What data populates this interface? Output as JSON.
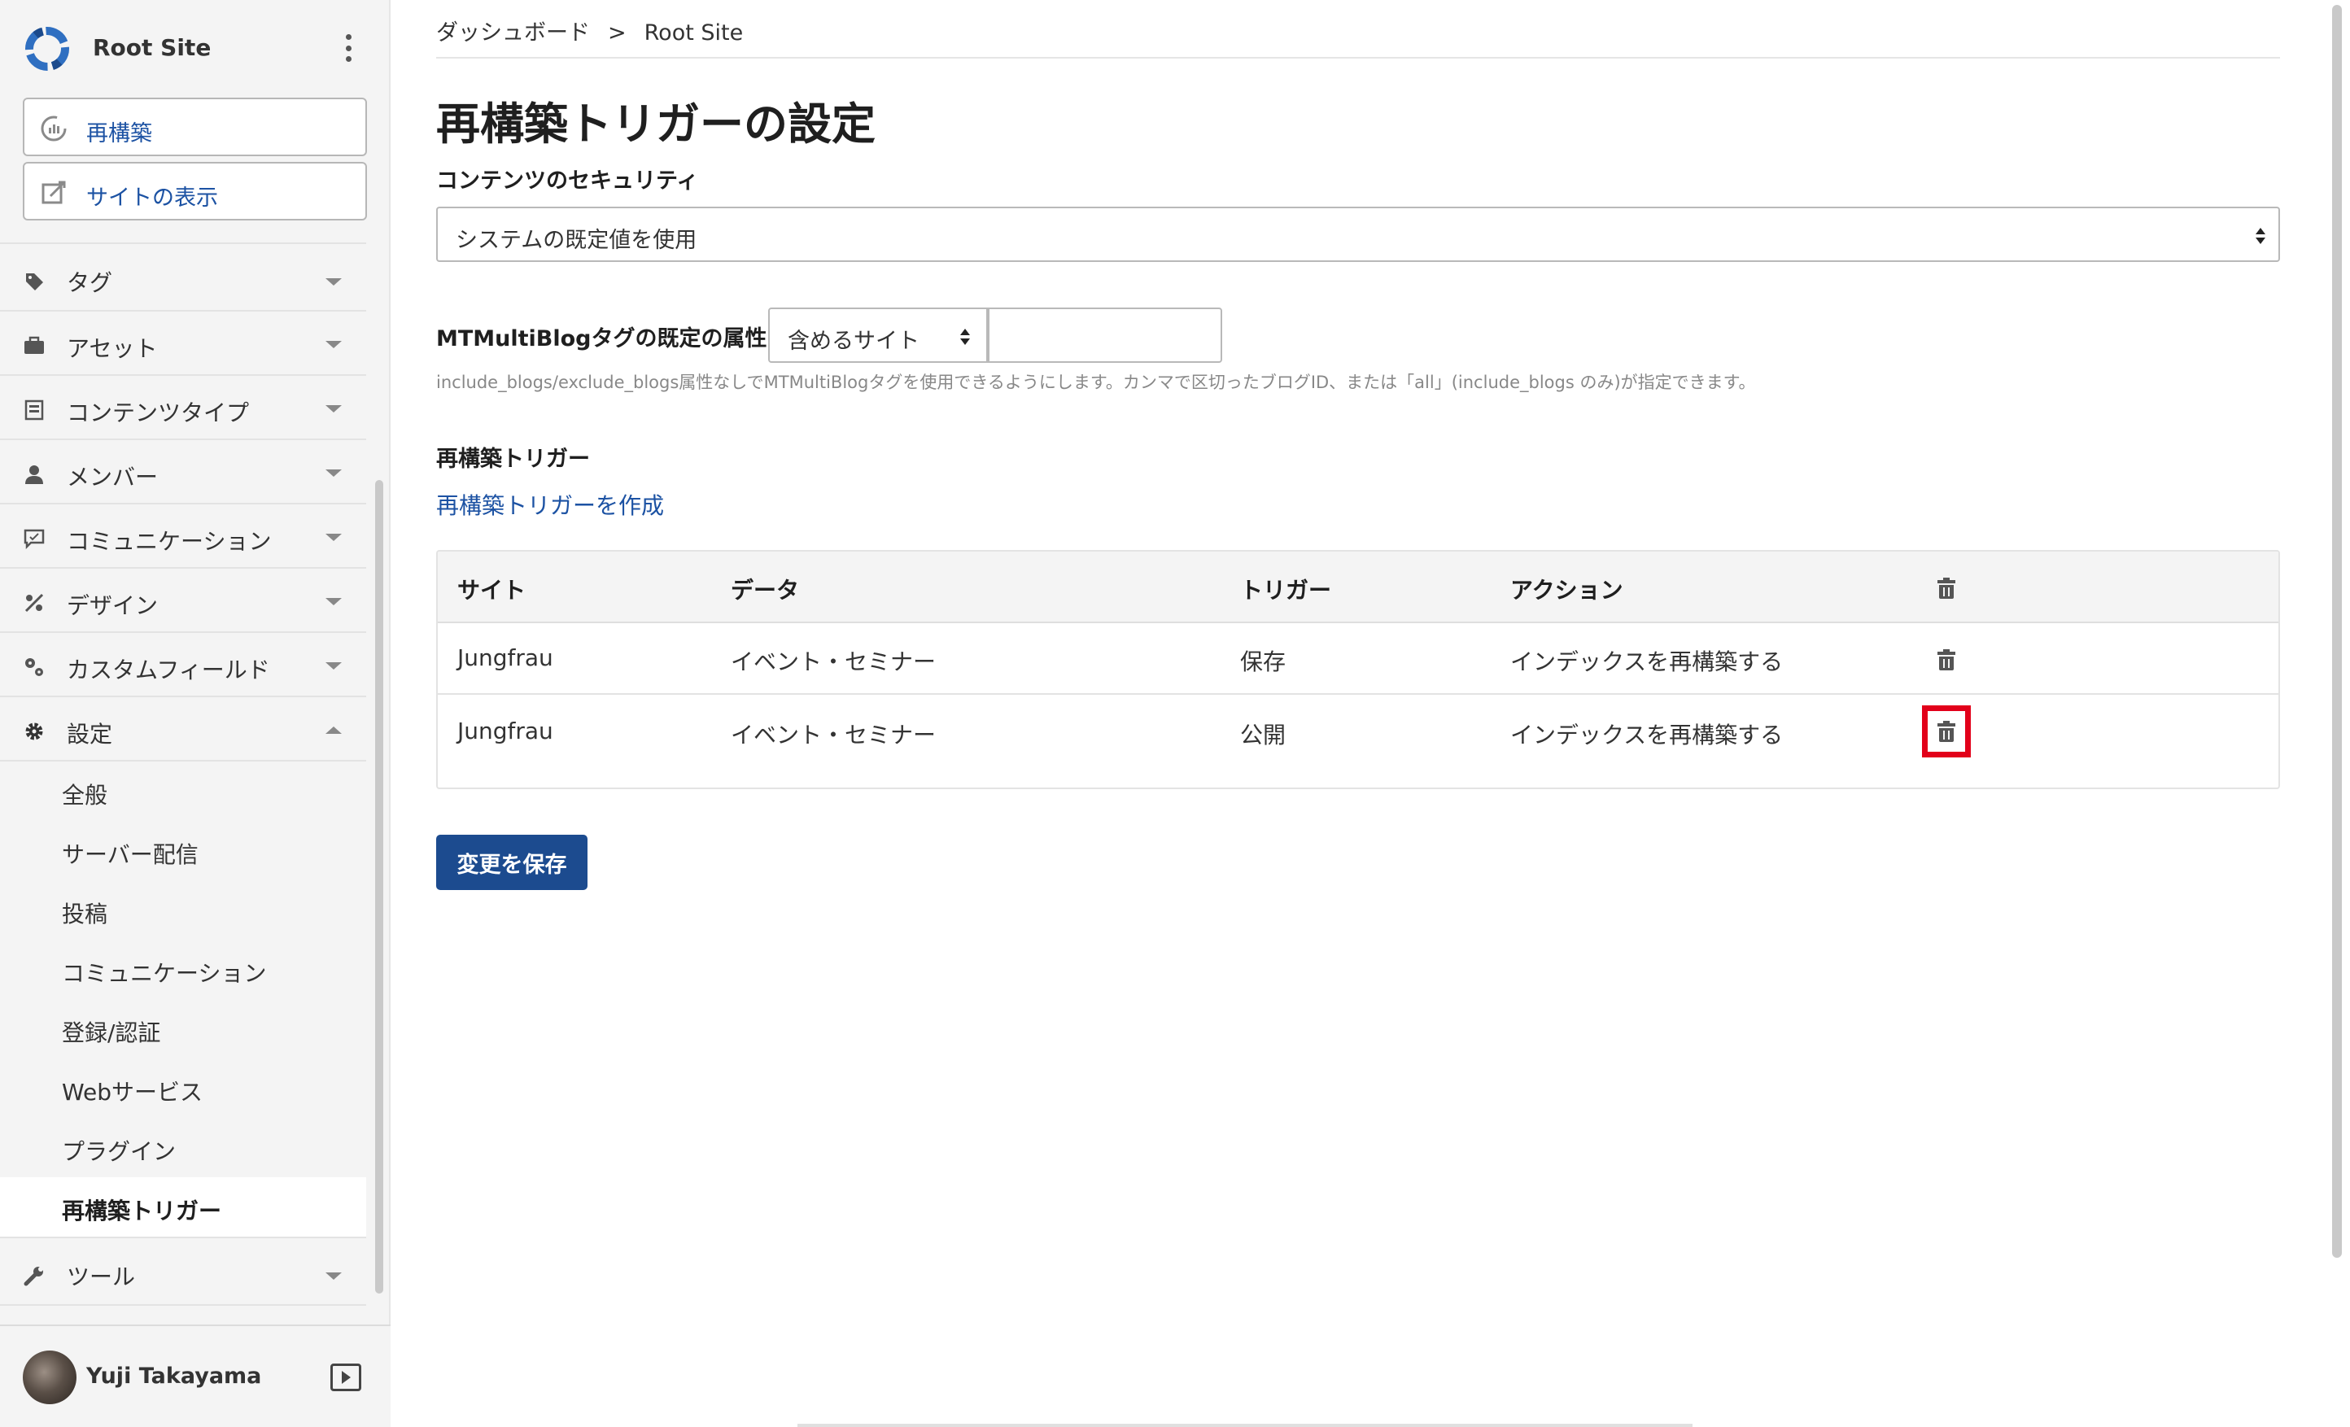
{
  "site": {
    "name": "Root Site"
  },
  "sidebar": {
    "actions": [
      {
        "label": "再構築",
        "icon": "rebuild-icon"
      },
      {
        "label": "サイトの表示",
        "icon": "external-edit-icon"
      }
    ],
    "menu": [
      {
        "label": "タグ",
        "icon": "tag-icon",
        "expanded": false
      },
      {
        "label": "アセット",
        "icon": "briefcase-icon",
        "expanded": false
      },
      {
        "label": "コンテンツタイプ",
        "icon": "content-type-icon",
        "expanded": false
      },
      {
        "label": "メンバー",
        "icon": "user-icon",
        "expanded": false
      },
      {
        "label": "コミュニケーション",
        "icon": "comment-icon",
        "expanded": false
      },
      {
        "label": "デザイン",
        "icon": "design-icon",
        "expanded": false
      },
      {
        "label": "カスタムフィールド",
        "icon": "custom-field-icon",
        "expanded": false
      },
      {
        "label": "設定",
        "icon": "gear-icon",
        "expanded": true
      },
      {
        "label": "ツール",
        "icon": "wrench-icon",
        "expanded": false
      }
    ],
    "settings_sub": [
      {
        "label": "全般"
      },
      {
        "label": "サーバー配信"
      },
      {
        "label": "投稿"
      },
      {
        "label": "コミュニケーション"
      },
      {
        "label": "登録/認証"
      },
      {
        "label": "Webサービス"
      },
      {
        "label": "プラグイン"
      },
      {
        "label": "再構築トリガー",
        "active": true
      }
    ],
    "user": {
      "name": "Yuji Takayama"
    }
  },
  "breadcrumb": {
    "items": [
      "ダッシュボード",
      "Root Site"
    ],
    "separator": ">"
  },
  "page": {
    "title": "再構築トリガーの設定",
    "content_security": {
      "label": "コンテンツのセキュリティ",
      "selected": "システムの既定値を使用"
    },
    "multiblog": {
      "label": "MTMultiBlogタグの既定の属性:",
      "selected": "含めるサイト",
      "input_value": "",
      "hint": "include_blogs/exclude_blogs属性なしでMTMultiBlogタグを使用できるようにします。カンマで区切ったブログID、または「all」(include_blogs のみ)が指定できます。"
    },
    "triggers": {
      "label": "再構築トリガー",
      "create_link": "再構築トリガーを作成",
      "columns": [
        "サイト",
        "データ",
        "トリガー",
        "アクション"
      ],
      "rows": [
        {
          "site": "Jungfrau",
          "data": "イベント・セミナー",
          "trigger": "保存",
          "action": "インデックスを再構築する"
        },
        {
          "site": "Jungfrau",
          "data": "イベント・セミナー",
          "trigger": "公開",
          "action": "インデックスを再構築する"
        }
      ]
    },
    "save_label": "変更を保存"
  },
  "colors": {
    "accent": "#1c52a3",
    "primary_button": "#1c4b8f",
    "highlight": "#e2001a"
  }
}
